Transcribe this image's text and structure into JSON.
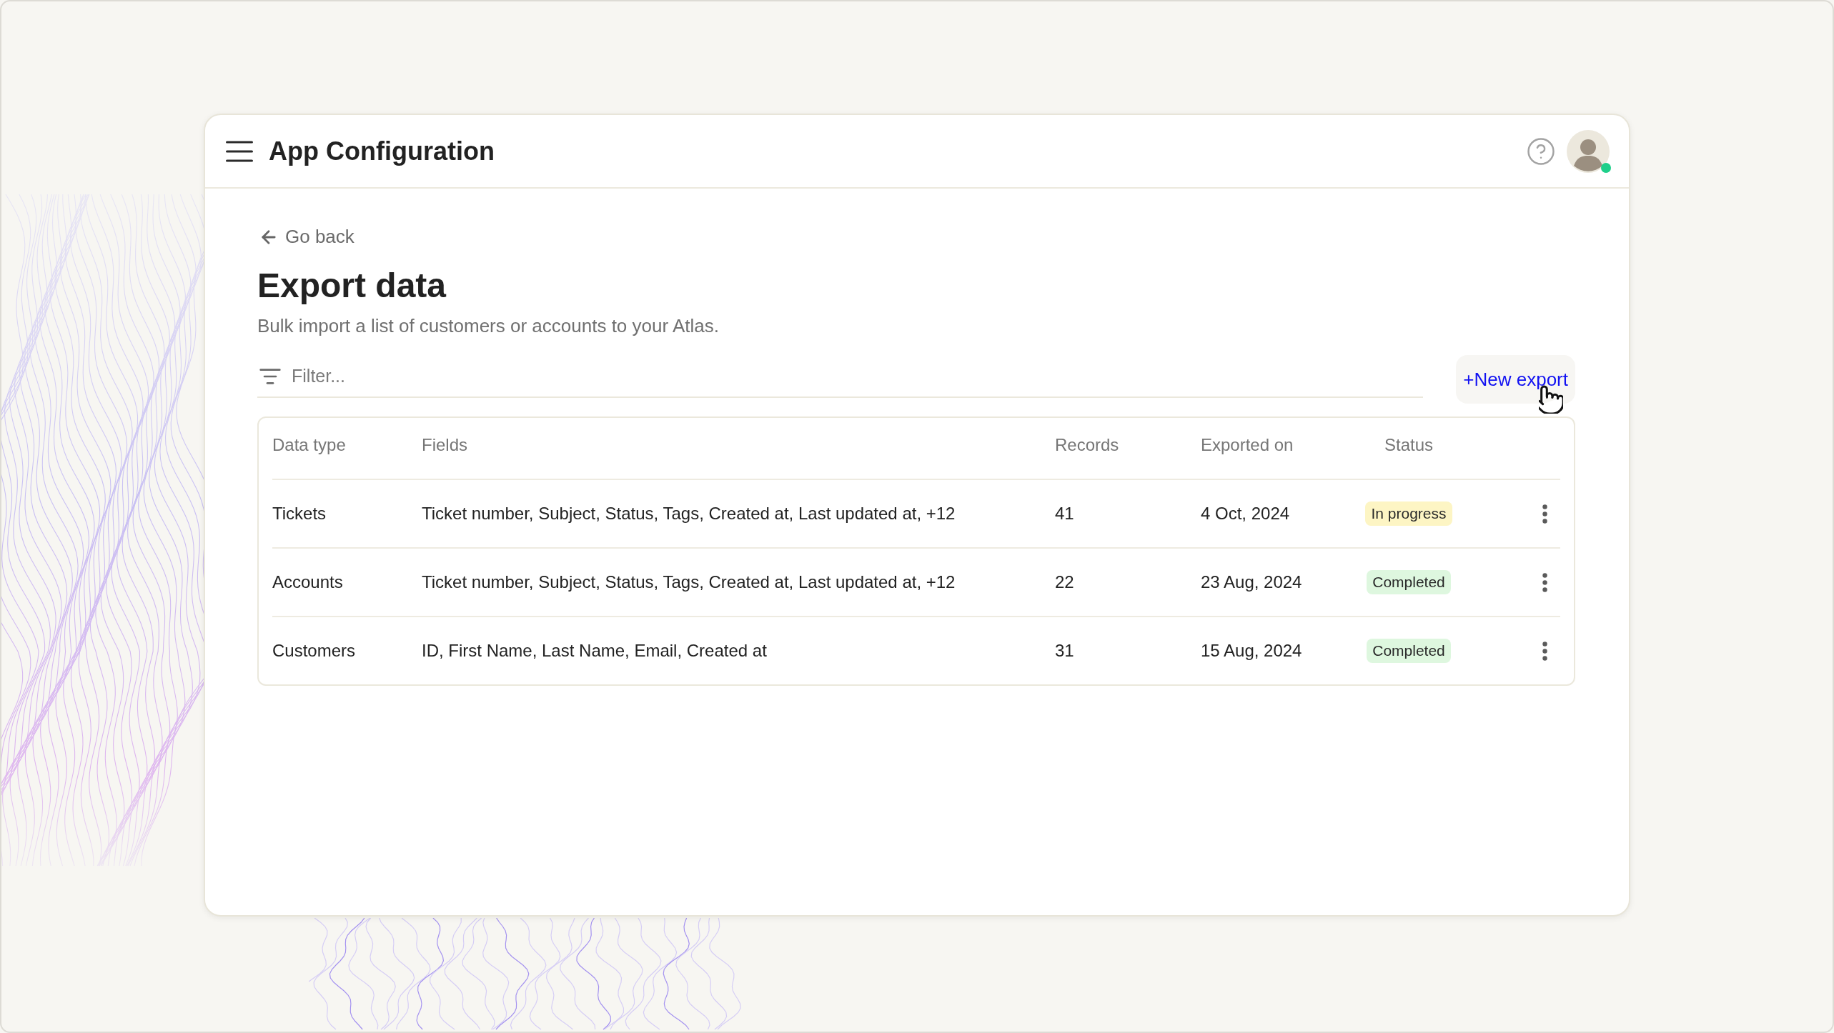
{
  "app_bar": {
    "title": "App Configuration",
    "user": {
      "online": true
    }
  },
  "page": {
    "back_link": "Go back",
    "title": "Export data",
    "subtitle": "Bulk import a list of customers or accounts to your Atlas.",
    "filter": {
      "placeholder": "Filter..."
    },
    "new_button": "+New export"
  },
  "table": {
    "columns": [
      "Data type",
      "Fields",
      "Records",
      "Exported on",
      "Status"
    ],
    "rows": [
      {
        "data_type": "Tickets",
        "fields": "Ticket number, Subject, Status, Tags, Created at, Last updated at, +12",
        "records": "41",
        "exported_on": "4 Oct, 2024",
        "status": {
          "label": "In progress",
          "color": "#fdf5c4"
        }
      },
      {
        "data_type": "Accounts",
        "fields": "Ticket number, Subject, Status, Tags, Created at, Last updated at, +12",
        "records": "22",
        "exported_on": "23 Aug, 2024",
        "status": {
          "label": "Completed",
          "color": "#def7df"
        }
      },
      {
        "data_type": "Customers",
        "fields": "ID, First Name, Last Name, Email, Created at",
        "records": "31",
        "exported_on": "15 Aug, 2024",
        "status": {
          "label": "Completed",
          "color": "#def7df"
        }
      }
    ]
  }
}
